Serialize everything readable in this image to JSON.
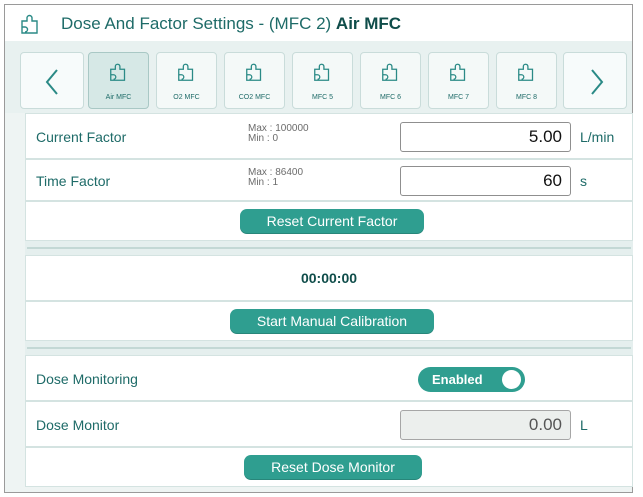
{
  "header": {
    "icon": "puzzle-icon",
    "title_prefix": "Dose And Factor Settings - (MFC 2) ",
    "title_bold": "Air MFC"
  },
  "tabs": [
    {
      "label": "Air MFC",
      "active": true
    },
    {
      "label": "O2 MFC",
      "active": false
    },
    {
      "label": "CO2 MFC",
      "active": false
    },
    {
      "label": "MFC 5",
      "active": false
    },
    {
      "label": "MFC 6",
      "active": false
    },
    {
      "label": "MFC 7",
      "active": false
    },
    {
      "label": "MFC 8",
      "active": false
    }
  ],
  "nav": {
    "prev_icon": "chevron-left-icon",
    "next_icon": "chevron-right-icon"
  },
  "current_factor": {
    "label": "Current Factor",
    "max": "Max  : 100000",
    "min": "Min   : 0",
    "value": "5.00",
    "unit": "L/min"
  },
  "time_factor": {
    "label": "Time Factor",
    "max": "Max  : 86400",
    "min": "Min   : 1",
    "value": "60",
    "unit": "s"
  },
  "buttons": {
    "reset_current_factor": "Reset Current Factor",
    "start_manual_calibration": "Start Manual Calibration",
    "reset_dose_monitor": "Reset Dose Monitor"
  },
  "timer": "00:00:00",
  "dose_monitoring": {
    "label": "Dose Monitoring",
    "toggle": "Enabled"
  },
  "dose_monitor": {
    "label": "Dose Monitor",
    "value": "0.00",
    "unit": "L"
  },
  "colors": {
    "accent": "#2f9e90",
    "text": "#1e6b68"
  }
}
